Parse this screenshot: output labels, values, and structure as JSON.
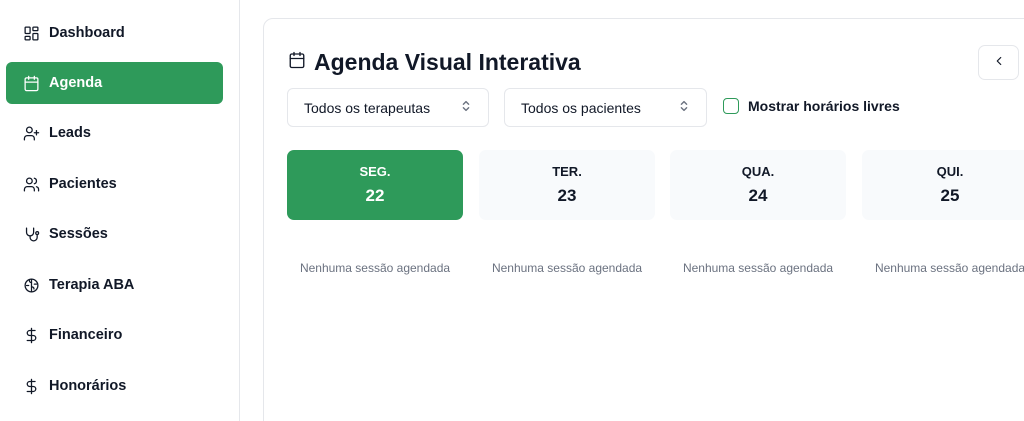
{
  "sidebar": {
    "items": [
      {
        "label": "Dashboard",
        "icon": "layout-grid-icon",
        "active": false
      },
      {
        "label": "Agenda",
        "icon": "calendar-icon",
        "active": true
      },
      {
        "label": "Leads",
        "icon": "user-plus-icon",
        "active": false
      },
      {
        "label": "Pacientes",
        "icon": "users-icon",
        "active": false
      },
      {
        "label": "Sessões",
        "icon": "stethoscope-icon",
        "active": false
      },
      {
        "label": "Terapia ABA",
        "icon": "brain-icon",
        "active": false
      },
      {
        "label": "Financeiro",
        "icon": "dollar-sign-icon",
        "active": false
      },
      {
        "label": "Honorários",
        "icon": "dollar-sign-icon",
        "active": false
      }
    ]
  },
  "agenda": {
    "title": "Agenda Visual Interativa",
    "title_icon": "calendar-icon",
    "back_icon": "chevron-left-icon",
    "filters": {
      "therapists": "Todos os terapeutas",
      "patients": "Todos os pacientes",
      "show_free_label": "Mostrar horários livres",
      "show_free_checked": false
    },
    "days": [
      {
        "name": "SEG.",
        "number": "22",
        "active": true,
        "empty": "Nenhuma sessão agendada"
      },
      {
        "name": "TER.",
        "number": "23",
        "active": false,
        "empty": "Nenhuma sessão agendada"
      },
      {
        "name": "QUA.",
        "number": "24",
        "active": false,
        "empty": "Nenhuma sessão agendada"
      },
      {
        "name": "QUI.",
        "number": "25",
        "active": false,
        "empty": "Nenhuma sessão agendada"
      }
    ]
  },
  "colors": {
    "accent": "#2e9a5a",
    "muted_text": "#6b7280",
    "border": "#e5e7eb",
    "day_bg": "#f8fafc"
  }
}
